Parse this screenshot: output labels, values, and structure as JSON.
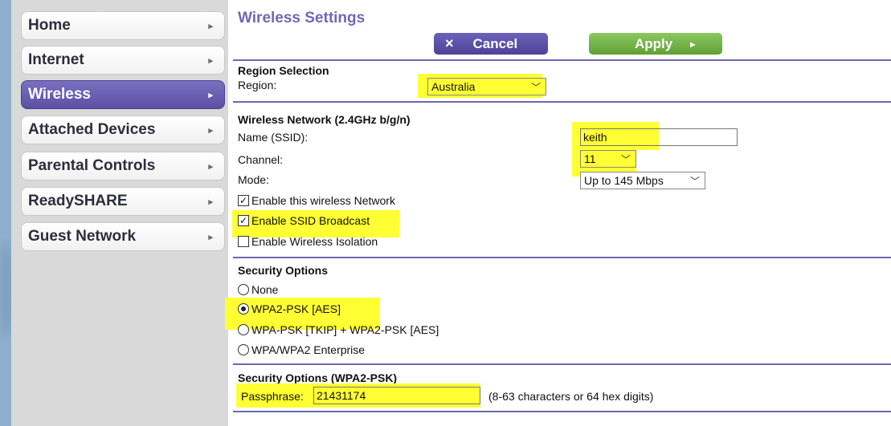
{
  "sidebar": {
    "items": [
      {
        "label": "Home"
      },
      {
        "label": "Internet"
      },
      {
        "label": "Wireless"
      },
      {
        "label": "Attached Devices"
      },
      {
        "label": "Parental Controls"
      },
      {
        "label": "ReadySHARE"
      },
      {
        "label": "Guest Network"
      }
    ],
    "arrow": "▸"
  },
  "page": {
    "title": "Wireless Settings",
    "cancel_icon": "×",
    "cancel_label": "Cancel",
    "apply_label": "Apply",
    "apply_icon": "▸"
  },
  "region": {
    "section_title": "Region Selection",
    "label": "Region:",
    "value": "Australia"
  },
  "wireless_network": {
    "section_title": "Wireless Network (2.4GHz b/g/n)",
    "ssid_label": "Name (SSID):",
    "ssid_value": "keith",
    "channel_label": "Channel:",
    "channel_value": "11",
    "mode_label": "Mode:",
    "mode_value": "Up to 145 Mbps",
    "enable_network_label": "Enable this wireless Network",
    "enable_network_checked": true,
    "ssid_broadcast_label": "Enable SSID Broadcast",
    "ssid_broadcast_checked": true,
    "isolation_label": "Enable Wireless Isolation",
    "isolation_checked": false
  },
  "security": {
    "section_title": "Security Options",
    "options": [
      {
        "label": "None",
        "selected": false
      },
      {
        "label": "WPA2-PSK [AES]",
        "selected": true
      },
      {
        "label": "WPA-PSK [TKIP] + WPA2-PSK [AES]",
        "selected": false
      },
      {
        "label": "WPA/WPA2 Enterprise",
        "selected": false
      }
    ]
  },
  "wpa2": {
    "section_title": "Security Options (WPA2-PSK)",
    "passphrase_label": "Passphrase:",
    "passphrase_value": "21431174",
    "hint": "(8-63 characters or 64 hex digits)"
  },
  "colors": {
    "highlight": "#ffff33",
    "accent": "#6d6ab6",
    "apply_green": "#5fa034"
  }
}
